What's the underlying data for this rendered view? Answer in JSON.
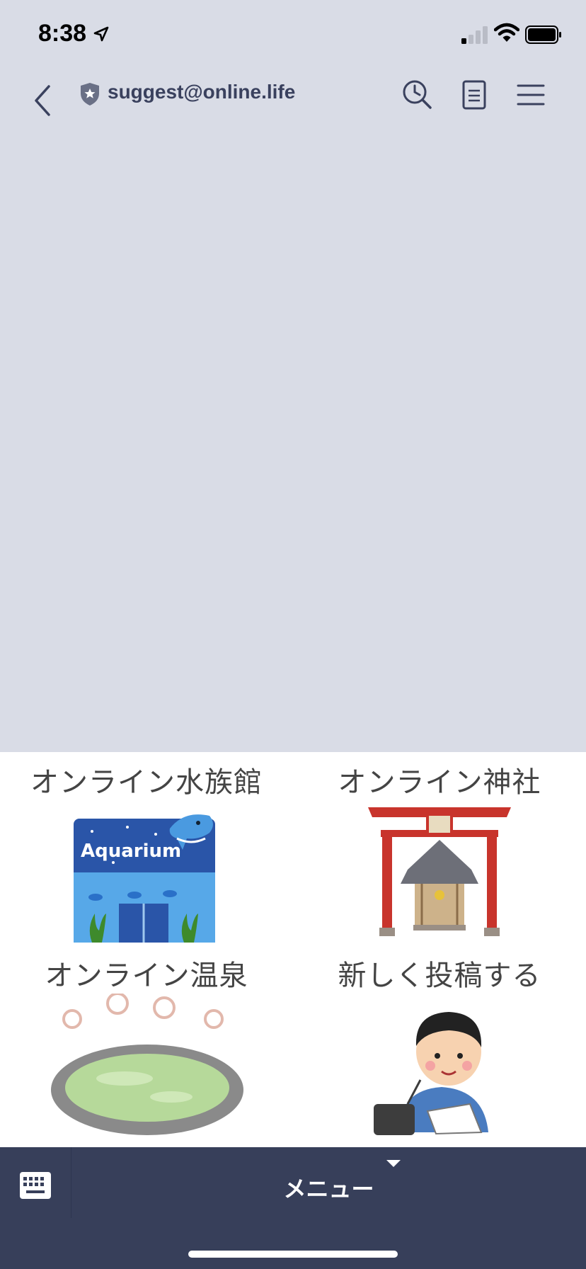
{
  "status": {
    "time": "8:38"
  },
  "header": {
    "title": "suggest@online.life"
  },
  "rich_menu": {
    "items": [
      {
        "label": "オンライン水族館",
        "art_text": "Aquarium"
      },
      {
        "label": "オンライン神社"
      },
      {
        "label": "オンライン温泉"
      },
      {
        "label": "新しく投稿する"
      }
    ]
  },
  "bottom_bar": {
    "menu_label": "メニュー"
  },
  "colors": {
    "chat_background": "#d9dce6",
    "header_text": "#3a415e",
    "bottom_bar": "#373f5a",
    "torii_red": "#c8342c",
    "aquarium_blue": "#2a55a8"
  },
  "icons": [
    "location-arrow-icon",
    "cellular-signal-icon",
    "wifi-icon",
    "battery-icon",
    "back-chevron-icon",
    "shield-star-icon",
    "search-clock-icon",
    "notes-icon",
    "hamburger-menu-icon",
    "keyboard-icon",
    "caret-down-icon"
  ]
}
